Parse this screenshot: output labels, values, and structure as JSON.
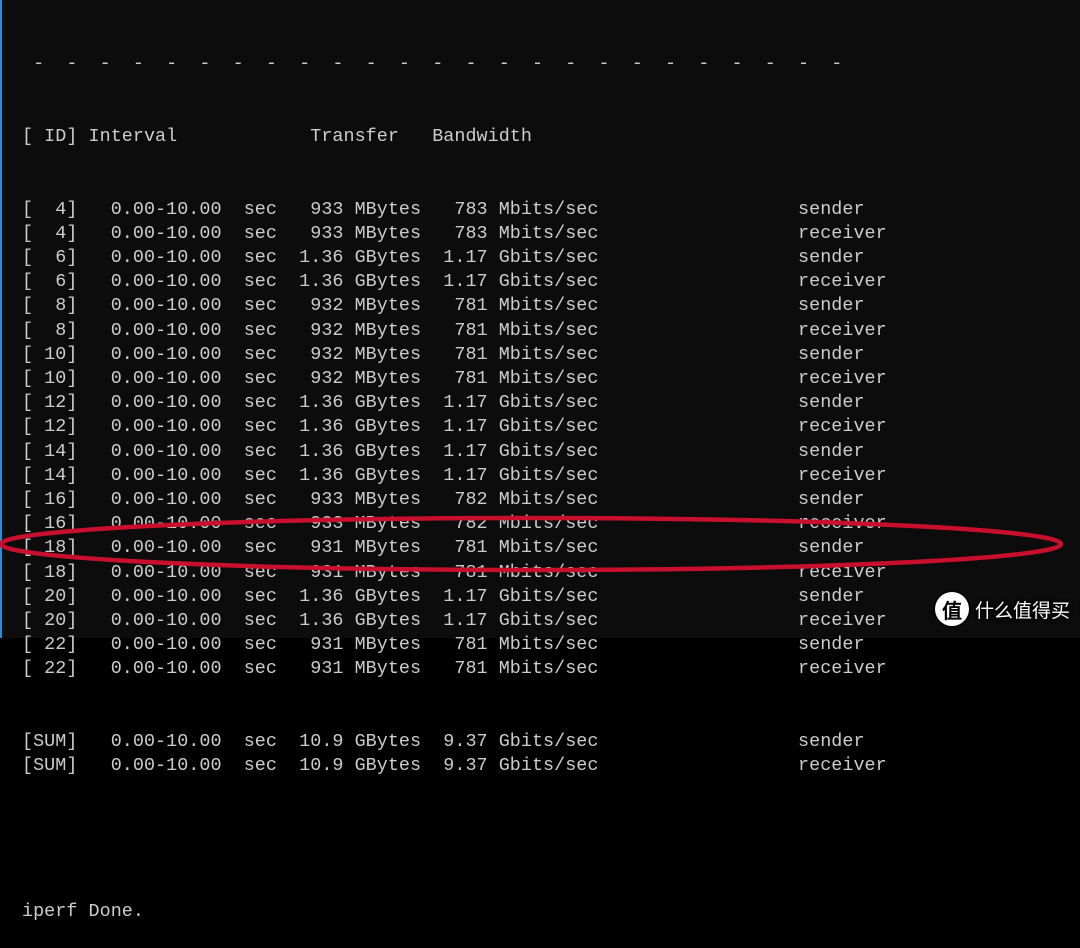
{
  "dash_line": " -  -  -  -  -  -  -  -  -  -  -  -  -  -  -  -  -  -  -  -  -  -  -  -  -",
  "header": {
    "id": "[ ID]",
    "interval": "Interval",
    "transfer": "Transfer",
    "bandwidth": "Bandwidth"
  },
  "rows": [
    {
      "id": "  4",
      "interval": "0.00-10.00",
      "unit": "sec",
      "tval": " 933",
      "tunit": "MBytes",
      "bval": " 783",
      "bunit": "Mbits/sec",
      "role": "sender"
    },
    {
      "id": "  4",
      "interval": "0.00-10.00",
      "unit": "sec",
      "tval": " 933",
      "tunit": "MBytes",
      "bval": " 783",
      "bunit": "Mbits/sec",
      "role": "receiver"
    },
    {
      "id": "  6",
      "interval": "0.00-10.00",
      "unit": "sec",
      "tval": "1.36",
      "tunit": "GBytes",
      "bval": "1.17",
      "bunit": "Gbits/sec",
      "role": "sender"
    },
    {
      "id": "  6",
      "interval": "0.00-10.00",
      "unit": "sec",
      "tval": "1.36",
      "tunit": "GBytes",
      "bval": "1.17",
      "bunit": "Gbits/sec",
      "role": "receiver"
    },
    {
      "id": "  8",
      "interval": "0.00-10.00",
      "unit": "sec",
      "tval": " 932",
      "tunit": "MBytes",
      "bval": " 781",
      "bunit": "Mbits/sec",
      "role": "sender"
    },
    {
      "id": "  8",
      "interval": "0.00-10.00",
      "unit": "sec",
      "tval": " 932",
      "tunit": "MBytes",
      "bval": " 781",
      "bunit": "Mbits/sec",
      "role": "receiver"
    },
    {
      "id": " 10",
      "interval": "0.00-10.00",
      "unit": "sec",
      "tval": " 932",
      "tunit": "MBytes",
      "bval": " 781",
      "bunit": "Mbits/sec",
      "role": "sender"
    },
    {
      "id": " 10",
      "interval": "0.00-10.00",
      "unit": "sec",
      "tval": " 932",
      "tunit": "MBytes",
      "bval": " 781",
      "bunit": "Mbits/sec",
      "role": "receiver"
    },
    {
      "id": " 12",
      "interval": "0.00-10.00",
      "unit": "sec",
      "tval": "1.36",
      "tunit": "GBytes",
      "bval": "1.17",
      "bunit": "Gbits/sec",
      "role": "sender"
    },
    {
      "id": " 12",
      "interval": "0.00-10.00",
      "unit": "sec",
      "tval": "1.36",
      "tunit": "GBytes",
      "bval": "1.17",
      "bunit": "Gbits/sec",
      "role": "receiver"
    },
    {
      "id": " 14",
      "interval": "0.00-10.00",
      "unit": "sec",
      "tval": "1.36",
      "tunit": "GBytes",
      "bval": "1.17",
      "bunit": "Gbits/sec",
      "role": "sender"
    },
    {
      "id": " 14",
      "interval": "0.00-10.00",
      "unit": "sec",
      "tval": "1.36",
      "tunit": "GBytes",
      "bval": "1.17",
      "bunit": "Gbits/sec",
      "role": "receiver"
    },
    {
      "id": " 16",
      "interval": "0.00-10.00",
      "unit": "sec",
      "tval": " 933",
      "tunit": "MBytes",
      "bval": " 782",
      "bunit": "Mbits/sec",
      "role": "sender"
    },
    {
      "id": " 16",
      "interval": "0.00-10.00",
      "unit": "sec",
      "tval": " 933",
      "tunit": "MBytes",
      "bval": " 782",
      "bunit": "Mbits/sec",
      "role": "receiver"
    },
    {
      "id": " 18",
      "interval": "0.00-10.00",
      "unit": "sec",
      "tval": " 931",
      "tunit": "MBytes",
      "bval": " 781",
      "bunit": "Mbits/sec",
      "role": "sender"
    },
    {
      "id": " 18",
      "interval": "0.00-10.00",
      "unit": "sec",
      "tval": " 931",
      "tunit": "MBytes",
      "bval": " 781",
      "bunit": "Mbits/sec",
      "role": "receiver"
    },
    {
      "id": " 20",
      "interval": "0.00-10.00",
      "unit": "sec",
      "tval": "1.36",
      "tunit": "GBytes",
      "bval": "1.17",
      "bunit": "Gbits/sec",
      "role": "sender"
    },
    {
      "id": " 20",
      "interval": "0.00-10.00",
      "unit": "sec",
      "tval": "1.36",
      "tunit": "GBytes",
      "bval": "1.17",
      "bunit": "Gbits/sec",
      "role": "receiver"
    },
    {
      "id": " 22",
      "interval": "0.00-10.00",
      "unit": "sec",
      "tval": " 931",
      "tunit": "MBytes",
      "bval": " 781",
      "bunit": "Mbits/sec",
      "role": "sender"
    },
    {
      "id": " 22",
      "interval": "0.00-10.00",
      "unit": "sec",
      "tval": " 931",
      "tunit": "MBytes",
      "bval": " 781",
      "bunit": "Mbits/sec",
      "role": "receiver"
    }
  ],
  "sum_rows": [
    {
      "id": "SUM",
      "interval": "0.00-10.00",
      "unit": "sec",
      "tval": "10.9",
      "tunit": "GBytes",
      "bval": "9.37",
      "bunit": "Gbits/sec",
      "role": "sender"
    },
    {
      "id": "SUM",
      "interval": "0.00-10.00",
      "unit": "sec",
      "tval": "10.9",
      "tunit": "GBytes",
      "bval": "9.37",
      "bunit": "Gbits/sec",
      "role": "receiver"
    }
  ],
  "done_line": "iperf Done.",
  "watermark": {
    "badge": "值",
    "text": "什么值得买"
  },
  "annotation_color": "#c8102e"
}
